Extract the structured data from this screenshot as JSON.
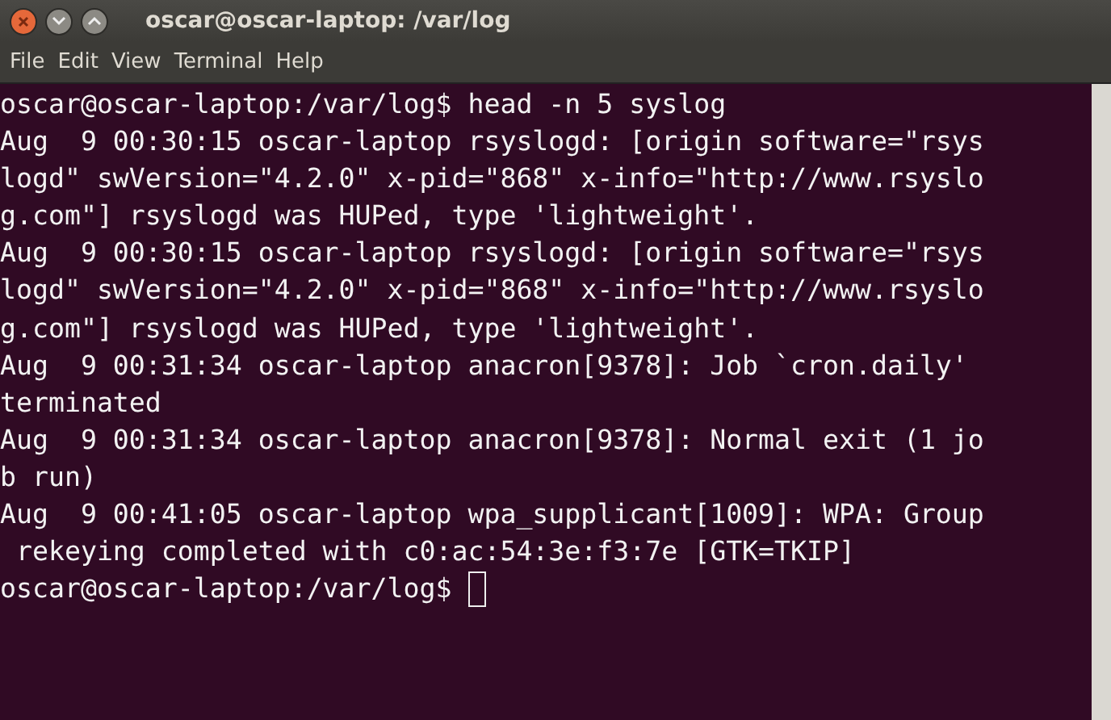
{
  "window": {
    "title": "oscar@oscar-laptop: /var/log"
  },
  "menu": [
    "File",
    "Edit",
    "View",
    "Terminal",
    "Help"
  ],
  "terminal": {
    "lines": [
      {
        "kind": "text",
        "text": "oscar@oscar-laptop:/var/log$ head -n 5 syslog"
      },
      {
        "kind": "text",
        "text": "Aug  9 00:30:15 oscar-laptop rsyslogd: [origin software=\"rsys"
      },
      {
        "kind": "text",
        "text": "logd\" swVersion=\"4.2.0\" x-pid=\"868\" x-info=\"http://www.rsyslo"
      },
      {
        "kind": "text",
        "text": "g.com\"] rsyslogd was HUPed, type 'lightweight'."
      },
      {
        "kind": "text",
        "text": "Aug  9 00:30:15 oscar-laptop rsyslogd: [origin software=\"rsys"
      },
      {
        "kind": "text",
        "text": "logd\" swVersion=\"4.2.0\" x-pid=\"868\" x-info=\"http://www.rsyslo"
      },
      {
        "kind": "text",
        "text": "g.com\"] rsyslogd was HUPed, type 'lightweight'."
      },
      {
        "kind": "text",
        "text": "Aug  9 00:31:34 oscar-laptop anacron[9378]: Job `cron.daily'"
      },
      {
        "kind": "text",
        "text": "terminated"
      },
      {
        "kind": "text",
        "text": "Aug  9 00:31:34 oscar-laptop anacron[9378]: Normal exit (1 jo"
      },
      {
        "kind": "text",
        "text": "b run)"
      },
      {
        "kind": "text",
        "text": "Aug  9 00:41:05 oscar-laptop wpa_supplicant[1009]: WPA: Group"
      },
      {
        "kind": "text",
        "text": " rekeying completed with c0:ac:54:3e:f3:7e [GTK=TKIP]"
      },
      {
        "kind": "prompt",
        "text": "oscar@oscar-laptop:/var/log$ "
      }
    ]
  }
}
